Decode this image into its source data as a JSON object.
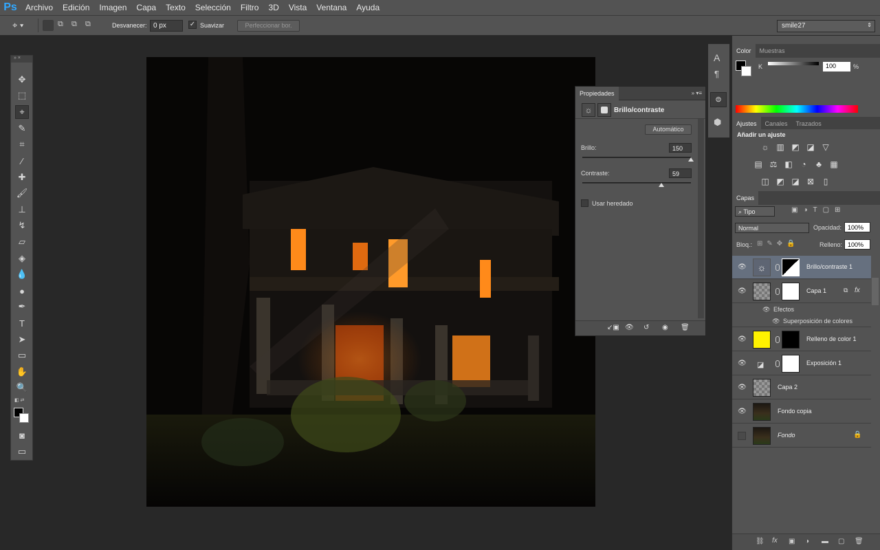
{
  "app": {
    "logo": "Ps"
  },
  "menu": [
    "Archivo",
    "Edición",
    "Imagen",
    "Capa",
    "Texto",
    "Selección",
    "Filtro",
    "3D",
    "Vista",
    "Ventana",
    "Ayuda"
  ],
  "options": {
    "feather_label": "Desvanecer:",
    "feather_value": "0 px",
    "smooth_label": "Suavizar",
    "refine_label": "Perfeccionar bor.",
    "workspace": "smile27"
  },
  "properties": {
    "tab": "Propiedades",
    "title": "Brillo/contraste",
    "auto_label": "Automático",
    "brightness_label": "Brillo:",
    "brightness_value": "150",
    "brightness_min": -150,
    "brightness_max": 150,
    "contrast_label": "Contraste:",
    "contrast_value": "59",
    "contrast_min": -50,
    "contrast_max": 100,
    "legacy_label": "Usar heredado"
  },
  "color_panel": {
    "tabs": [
      "Color",
      "Muestras"
    ],
    "channel_label": "K",
    "value": "100",
    "unit": "%"
  },
  "adjustments": {
    "tabs": [
      "Ajustes",
      "Canales",
      "Trazados"
    ],
    "title": "Añadir un ajuste"
  },
  "layers_panel": {
    "tab": "Capas",
    "filter_kind": "Tipo",
    "blend_mode": "Normal",
    "opacity_label": "Opacidad:",
    "opacity_value": "100%",
    "lock_label": "Bloq.:",
    "fill_label": "Relleno:",
    "fill_value": "100%",
    "layers": [
      {
        "name": "Brillo/contraste 1",
        "selected": true
      },
      {
        "name": "Capa 1",
        "effects_label": "Efectos",
        "effect": "Superposición de colores"
      },
      {
        "name": "Relleno de color 1",
        "fill_color": "#fff200"
      },
      {
        "name": "Exposición 1"
      },
      {
        "name": "Capa 2"
      },
      {
        "name": "Fondo copia"
      },
      {
        "name": "Fondo"
      }
    ]
  }
}
